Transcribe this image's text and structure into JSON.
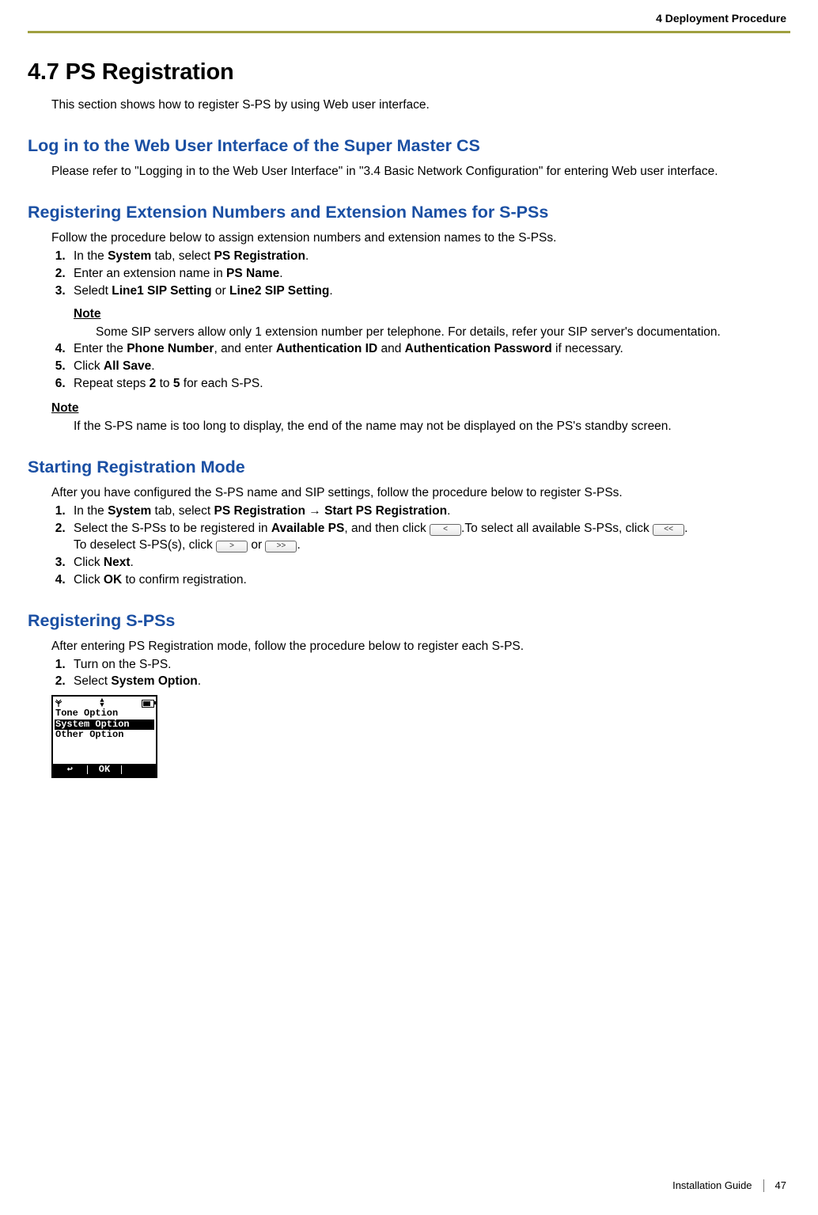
{
  "header": {
    "running": "4 Deployment Procedure"
  },
  "title": "4.7  PS Registration",
  "intro": "This section shows how to register S-PS by using Web user interface.",
  "sections": {
    "login": {
      "heading": "Log in to the Web User Interface of the Super Master CS",
      "body": "Please refer to \"Logging in to the Web User Interface\" in \"3.4  Basic Network Configuration\" for entering Web user interface."
    },
    "register_ext": {
      "heading": "Registering Extension Numbers and Extension Names for S-PSs",
      "lead": "Follow the procedure below to assign extension numbers and extension names to the S-PSs.",
      "step1_a": "In the ",
      "step1_b": "System",
      "step1_c": " tab, select ",
      "step1_d": "PS Registration",
      "step1_e": ".",
      "step2_a": "Enter an extension name in ",
      "step2_b": "PS Name",
      "step2_c": ".",
      "step3_a": "Seledt ",
      "step3_b": "Line1 SIP Setting",
      "step3_c": " or ",
      "step3_d": "Line2 SIP Setting",
      "step3_e": ".",
      "note1_label": "Note",
      "note1_body": "Some SIP servers allow only 1 extension number per telephone. For details, refer your SIP server's documentation.",
      "step4_a": "Enter the ",
      "step4_b": "Phone Number",
      "step4_c": ", and enter ",
      "step4_d": "Authentication ID",
      "step4_e": " and ",
      "step4_f": "Authentication Password",
      "step4_g": " if necessary.",
      "step5_a": "Click ",
      "step5_b": "All Save",
      "step5_c": ".",
      "step6_a": "Repeat steps ",
      "step6_b": "2",
      "step6_c": " to ",
      "step6_d": "5",
      "step6_e": " for each S-PS.",
      "note2_label": "Note",
      "note2_body": "If the S-PS name is too long to display, the end of the name may not be displayed on the PS's standby screen."
    },
    "start_mode": {
      "heading": "Starting Registration Mode",
      "lead": "After you have configured the S-PS name and SIP settings, follow the procedure below to register S-PSs.",
      "step1_a": "In the ",
      "step1_b": "System",
      "step1_c": " tab, select ",
      "step1_d": "PS Registration",
      "step1_arrow": " → ",
      "step1_e": "Start PS Registration",
      "step1_f": ".",
      "step2_a": "Select the S-PSs to be registered in ",
      "step2_b": "Available PS",
      "step2_c": ", and then click ",
      "btn_lt": "<",
      "step2_d": ".To select all available S-PSs, click ",
      "btn_ltlt": "<<",
      "step2_e": ".",
      "step2_line2_a": "To deselect S-PS(s), click ",
      "btn_gt": ">",
      "step2_line2_b": " or ",
      "btn_gtgt": ">>",
      "step2_line2_c": ".",
      "step3_a": "Click ",
      "step3_b": "Next",
      "step3_c": ".",
      "step4_a": "Click ",
      "step4_b": "OK",
      "step4_c": " to confirm registration."
    },
    "register_sps": {
      "heading": "Registering S-PSs",
      "lead": "After entering PS Registration mode, follow the procedure below to register each S-PS.",
      "step1": "Turn on the S-PS.",
      "step2_a": "Select ",
      "step2_b": "System Option",
      "step2_c": "."
    }
  },
  "phone": {
    "items": [
      "Tone Option",
      "System Option",
      "Other Option"
    ],
    "selected_index": 1,
    "soft_left": "↩",
    "soft_mid": "OK"
  },
  "footer": {
    "doc": "Installation Guide",
    "page": "47"
  }
}
